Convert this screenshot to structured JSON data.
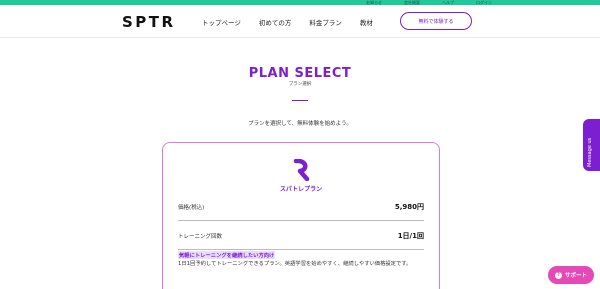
{
  "topbar": {
    "links": [
      "お知らせ",
      "会社概要",
      "ヘルプ",
      "ログイン"
    ],
    "color": "#22c79a"
  },
  "header": {
    "logo": "SPTR",
    "nav": [
      "トップページ",
      "初めての方",
      "料金プラン",
      "教材"
    ],
    "trial_button": "無料で体験する"
  },
  "page": {
    "title": "PLAN SELECT",
    "subtitle": "プラン選択",
    "intro": "プランを選択して、無料体験を始めよう。"
  },
  "plan_card": {
    "name": "スパトレプラン",
    "rows": [
      {
        "label": "価格(税込)",
        "value": "5,980円"
      },
      {
        "label": "トレーニング回数",
        "value": "1日/1回"
      }
    ],
    "highlight": "気軽にトレーニングを継続したい方向け",
    "description": "1日1回予約してトレーニングできるプラン。英語学習を始めやすく、継続しやすい価格設定です。"
  },
  "floating": {
    "message_tab": "Message us",
    "support_button": "サポート"
  },
  "colors": {
    "accent": "#7b1fd0",
    "card_border": "#e07ad6",
    "support": "#e449b6"
  }
}
